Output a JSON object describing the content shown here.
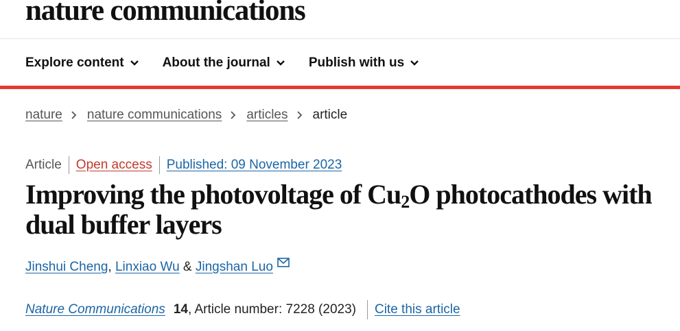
{
  "site": {
    "logo": "nature communications"
  },
  "nav": {
    "items": [
      {
        "label": "Explore content"
      },
      {
        "label": "About the journal"
      },
      {
        "label": "Publish with us"
      }
    ]
  },
  "breadcrumb": {
    "items": [
      {
        "label": "nature"
      },
      {
        "label": "nature communications"
      },
      {
        "label": "articles"
      }
    ],
    "current": "article"
  },
  "article": {
    "type": "Article",
    "access": "Open access",
    "published": "Published: 09 November 2023",
    "title_part1": "Improving the photovoltage of Cu",
    "title_sub": "2",
    "title_part2": "O photocathodes with dual buffer layers",
    "authors": [
      {
        "name": "Jinshui Cheng"
      },
      {
        "name": "Linxiao Wu"
      },
      {
        "name": "Jingshan Luo"
      }
    ],
    "author_sep_1": ", ",
    "author_sep_2": " & ",
    "journal": "Nature Communications",
    "volume": "14",
    "article_number": ", Article number: 7228 (2023)",
    "cite_label": "Cite this article"
  },
  "colors": {
    "accent": "#e5392d",
    "link": "#1a65a6",
    "open_access": "#c0392b"
  },
  "icons": {
    "nav_dropdown": "chevron-down-icon",
    "breadcrumb_separator": "chevron-right-icon",
    "corresponding_author": "mail-icon"
  }
}
